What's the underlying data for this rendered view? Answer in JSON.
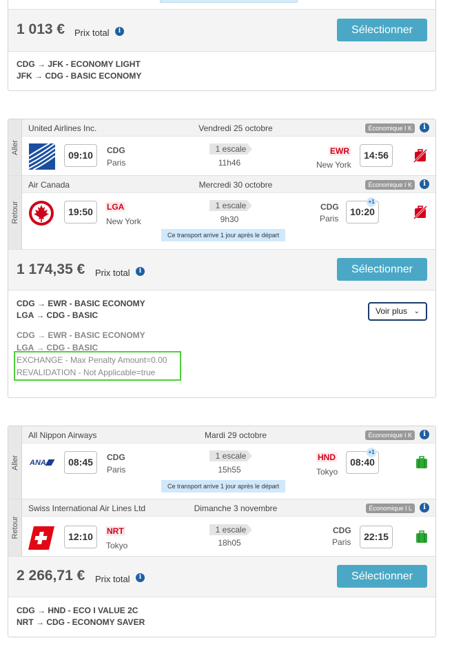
{
  "offer1": {
    "price": "1 013 €",
    "price_label": "Prix total",
    "button": "Sélectionner",
    "fares": [
      "CDG → JFK - ECONOMY LIGHT",
      "JFK → CDG - BASIC ECONOMY"
    ]
  },
  "offer2": {
    "aller": {
      "side_label": "Aller",
      "airline": "United Airlines Inc.",
      "date": "Vendredi 25 octobre",
      "cabin": "Économique I K",
      "logo": "united-logo",
      "dep_time": "09:10",
      "dep_code": "CDG",
      "dep_city": "Paris",
      "stops": "1 escale",
      "duration": "11h46",
      "arr_code": "EWR",
      "arr_city": "New York",
      "arr_time": "14:56",
      "baggage": "no-baggage-icon"
    },
    "retour": {
      "side_label": "Retour",
      "airline": "Air Canada",
      "date": "Mercredi 30 octobre",
      "cabin": "Économique I K",
      "logo": "air-canada-logo",
      "dep_time": "19:50",
      "dep_code": "LGA",
      "dep_city": "New York",
      "stops": "1 escale",
      "duration": "9h30",
      "arr_code": "CDG",
      "arr_city": "Paris",
      "arr_time": "10:20",
      "day_offset": "+1",
      "note": "Ce transport arrive 1 jour après le départ",
      "baggage": "no-baggage-icon"
    },
    "price": "1 174,35 €",
    "price_label": "Prix total",
    "button": "Sélectionner",
    "fares": [
      "CDG → EWR - BASIC ECONOMY",
      "LGA → CDG - BASIC"
    ],
    "voir_plus": "Voir plus",
    "expanded_fares": [
      "CDG → EWR - BASIC ECONOMY",
      "LGA → CDG - BASIC"
    ],
    "rules": [
      "EXCHANGE - Max Penalty Amount=0.00",
      "REVALIDATION - Not Applicable=true"
    ]
  },
  "offer3": {
    "aller": {
      "side_label": "Aller",
      "airline": "All Nippon Airways",
      "date": "Mardi 29 octobre",
      "cabin": "Économique I K",
      "logo": "ana-logo",
      "logo_text": "ANA",
      "dep_time": "08:45",
      "dep_code": "CDG",
      "dep_city": "Paris",
      "stops": "1 escale",
      "duration": "15h55",
      "arr_code": "HND",
      "arr_city": "Tokyo",
      "arr_time": "08:40",
      "day_offset": "+1",
      "note": "Ce transport arrive 1 jour après le départ",
      "baggage": "baggage-icon"
    },
    "retour": {
      "side_label": "Retour",
      "airline": "Swiss International Air Lines Ltd",
      "date": "Dimanche 3 novembre",
      "cabin": "Économique I L",
      "logo": "swiss-logo",
      "dep_time": "12:10",
      "dep_code": "NRT",
      "dep_city": "Tokyo",
      "stops": "1 escale",
      "duration": "18h05",
      "arr_code": "CDG",
      "arr_city": "Paris",
      "arr_time": "22:15",
      "baggage": "baggage-icon"
    },
    "price": "2 266,71 €",
    "price_label": "Prix total",
    "button": "Sélectionner",
    "fares": [
      "CDG → HND - ECO I VALUE 2C",
      "NRT → CDG - ECONOMY SAVER"
    ]
  },
  "colors": {
    "accent_button": "#4aa8c6",
    "info_icon": "#1f5fa3",
    "red_code": "#d0021b",
    "baggage_green": "#2ea836",
    "no_baggage_red": "#d0021b",
    "highlight": "#4cd137"
  }
}
